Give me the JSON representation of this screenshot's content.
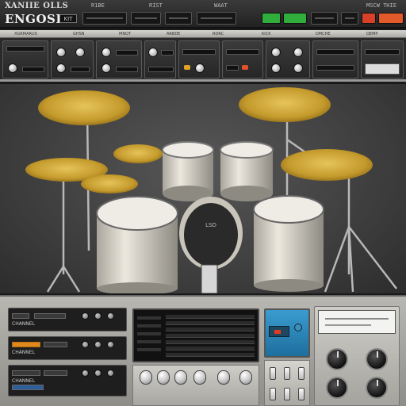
{
  "app": {
    "title_line1": "XANIIE  OLLS",
    "title_line2": "ENGOSIS",
    "kit_badge": "KIT",
    "top_right_label": "MSCW THIE"
  },
  "top_bar": {
    "labels": [
      "R1BE",
      "RIST",
      "WAAT"
    ],
    "buttons": [
      {
        "color": "#2fae3c"
      },
      {
        "color": "#2fae3c"
      },
      {
        "color": "#d8402a"
      },
      {
        "color": "#e35a2a"
      }
    ]
  },
  "rack_strip_labels": [
    "XGRMARUS",
    "GHSN",
    "MNOT",
    "ARBDE",
    "RORC",
    "KICK",
    "DMCHE",
    "OEMP"
  ],
  "stage": {
    "kick_logo": "LSD",
    "colors": {
      "cymbal": "#c9a33a",
      "drum_shell": "#e6e2d8",
      "hardware": "#bdbdbd",
      "kick_head": "#2a2a2a"
    }
  },
  "bottom": {
    "strip_labels": [
      "CHANNEL",
      "CHANNEL",
      "CHANNEL"
    ],
    "lcd_color": "#2b87bd",
    "accent_orange": "#e08a1e"
  }
}
